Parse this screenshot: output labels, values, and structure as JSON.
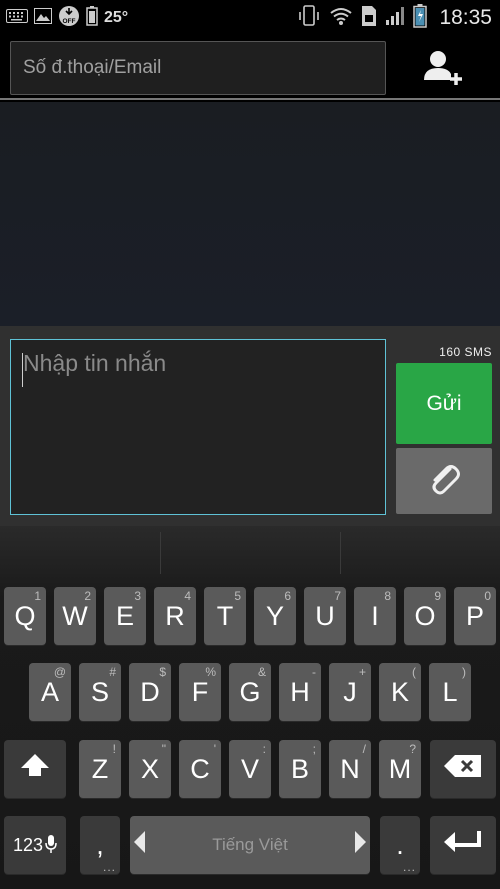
{
  "status_bar": {
    "left_icons": [
      "keyboard-icon",
      "image-icon",
      "download-off-icon",
      "battery-small-icon"
    ],
    "off_badge": "OFF",
    "temperature": "25°",
    "right_icons": [
      "phone-vibrate-icon",
      "wifi-icon",
      "sim-icon",
      "signal-icon",
      "battery-charging-icon"
    ],
    "time": "18:35"
  },
  "header": {
    "recipient_placeholder": "Số đ.thoại/Email",
    "add_contact_icon": "add-contact-icon"
  },
  "compose": {
    "message_placeholder": "Nhập tin nhắn",
    "counter": "160  SMS",
    "send_label": "Gửi",
    "attach_icon": "paperclip-icon",
    "focus_color": "#5fc2d6",
    "send_color": "#29a646"
  },
  "keyboard": {
    "row1": [
      {
        "label": "Q",
        "hint": "1"
      },
      {
        "label": "W",
        "hint": "2"
      },
      {
        "label": "E",
        "hint": "3"
      },
      {
        "label": "R",
        "hint": "4"
      },
      {
        "label": "T",
        "hint": "5"
      },
      {
        "label": "Y",
        "hint": "6"
      },
      {
        "label": "U",
        "hint": "7"
      },
      {
        "label": "I",
        "hint": "8"
      },
      {
        "label": "O",
        "hint": "9"
      },
      {
        "label": "P",
        "hint": "0"
      }
    ],
    "row2": [
      {
        "label": "A",
        "hint": "@"
      },
      {
        "label": "S",
        "hint": "#"
      },
      {
        "label": "D",
        "hint": "$"
      },
      {
        "label": "F",
        "hint": "%"
      },
      {
        "label": "G",
        "hint": "&"
      },
      {
        "label": "H",
        "hint": "-"
      },
      {
        "label": "J",
        "hint": "+"
      },
      {
        "label": "K",
        "hint": "("
      },
      {
        "label": "L",
        "hint": ")"
      }
    ],
    "row3": [
      {
        "label": "Z",
        "hint": "!"
      },
      {
        "label": "X",
        "hint": "\""
      },
      {
        "label": "C",
        "hint": "'"
      },
      {
        "label": "V",
        "hint": ":"
      },
      {
        "label": "B",
        "hint": ";"
      },
      {
        "label": "N",
        "hint": "/"
      },
      {
        "label": "M",
        "hint": "?"
      }
    ],
    "symbols_key": "123",
    "comma_key": ",",
    "space_label": "Tiếng Việt",
    "period_key": ".",
    "more_dots": "...",
    "shift_icon": "shift-icon",
    "backspace_icon": "backspace-icon",
    "enter_icon": "enter-icon",
    "mic_icon": "mic-icon"
  }
}
